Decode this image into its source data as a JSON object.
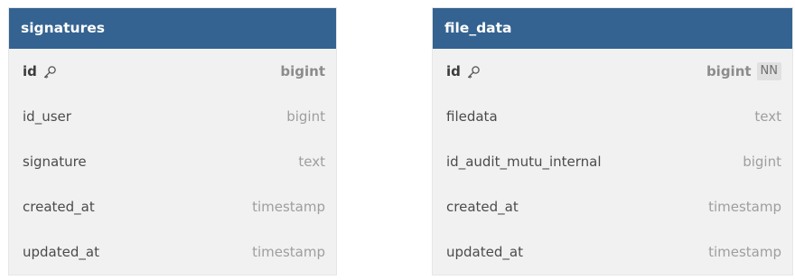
{
  "tables": [
    {
      "name": "signatures",
      "columns": [
        {
          "name": "id",
          "type": "bigint",
          "primary_key": true,
          "icon": "key-icon"
        },
        {
          "name": "id_user",
          "type": "bigint"
        },
        {
          "name": "signature",
          "type": "text"
        },
        {
          "name": "created_at",
          "type": "timestamp"
        },
        {
          "name": "updated_at",
          "type": "timestamp"
        }
      ]
    },
    {
      "name": "file_data",
      "columns": [
        {
          "name": "id",
          "type": "bigint",
          "primary_key": true,
          "icon": "key-icon",
          "badge": "NN"
        },
        {
          "name": "filedata",
          "type": "text"
        },
        {
          "name": "id_audit_mutu_internal",
          "type": "bigint"
        },
        {
          "name": "created_at",
          "type": "timestamp"
        },
        {
          "name": "updated_at",
          "type": "timestamp"
        }
      ]
    }
  ],
  "colors": {
    "header_bg": "#346391",
    "header_text": "#ffffff",
    "table_bg": "#f1f1f1",
    "name_text": "#4b4b4b",
    "type_text": "#9e9e9e",
    "badge_bg": "#e0e0e0"
  }
}
